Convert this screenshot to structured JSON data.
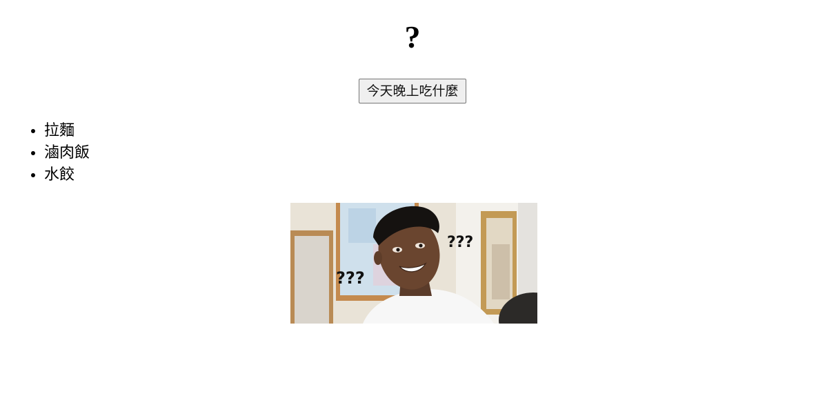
{
  "page": {
    "title": "?"
  },
  "controls": {
    "button_label": "今天晚上吃什麼"
  },
  "food_list": {
    "items": [
      "拉麵",
      "滷肉飯",
      "水餃"
    ]
  },
  "image": {
    "description_icon": "confused-man-meme-image",
    "marks": {
      "left": "???",
      "right": "???"
    }
  }
}
